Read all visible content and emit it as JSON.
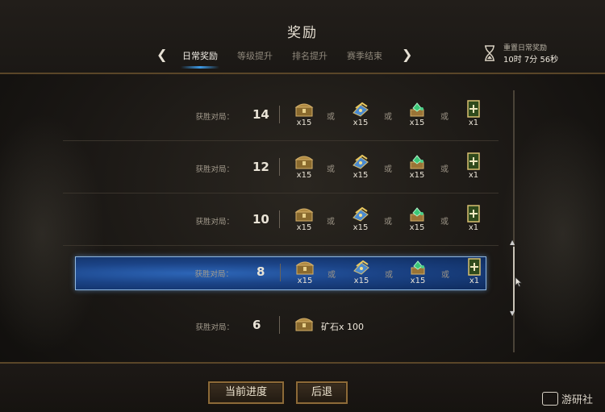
{
  "header": {
    "title": "奖励",
    "tabs": [
      "日常奖励",
      "等级提升",
      "排名提升",
      "赛季结束"
    ],
    "active_tab": 0,
    "reset_label": "重置日常奖励",
    "reset_time": "10时 7分 56秒"
  },
  "rewards": {
    "or_text": "或",
    "rows": [
      {
        "label": "获胜对局：",
        "count": "14",
        "items": [
          "x15",
          "x15",
          "x15",
          "x1"
        ]
      },
      {
        "label": "获胜对局：",
        "count": "12",
        "items": [
          "x15",
          "x15",
          "x15",
          "x1"
        ]
      },
      {
        "label": "获胜对局：",
        "count": "10",
        "items": [
          "x15",
          "x15",
          "x15",
          "x1"
        ]
      },
      {
        "label": "获胜对局：",
        "count": "8",
        "items": [
          "x15",
          "x15",
          "x15",
          "x1"
        ]
      },
      {
        "label": "获胜对局：",
        "count": "6",
        "ore_text": "矿石x 100"
      }
    ],
    "selected_row": 3
  },
  "footer": {
    "progress_button": "当前进度",
    "back_button": "后退"
  },
  "watermark": {
    "text": "游研社"
  },
  "colors": {
    "accent": "#3d9be8",
    "frame": "#8c6a38",
    "selected_row": "#1b4386"
  }
}
